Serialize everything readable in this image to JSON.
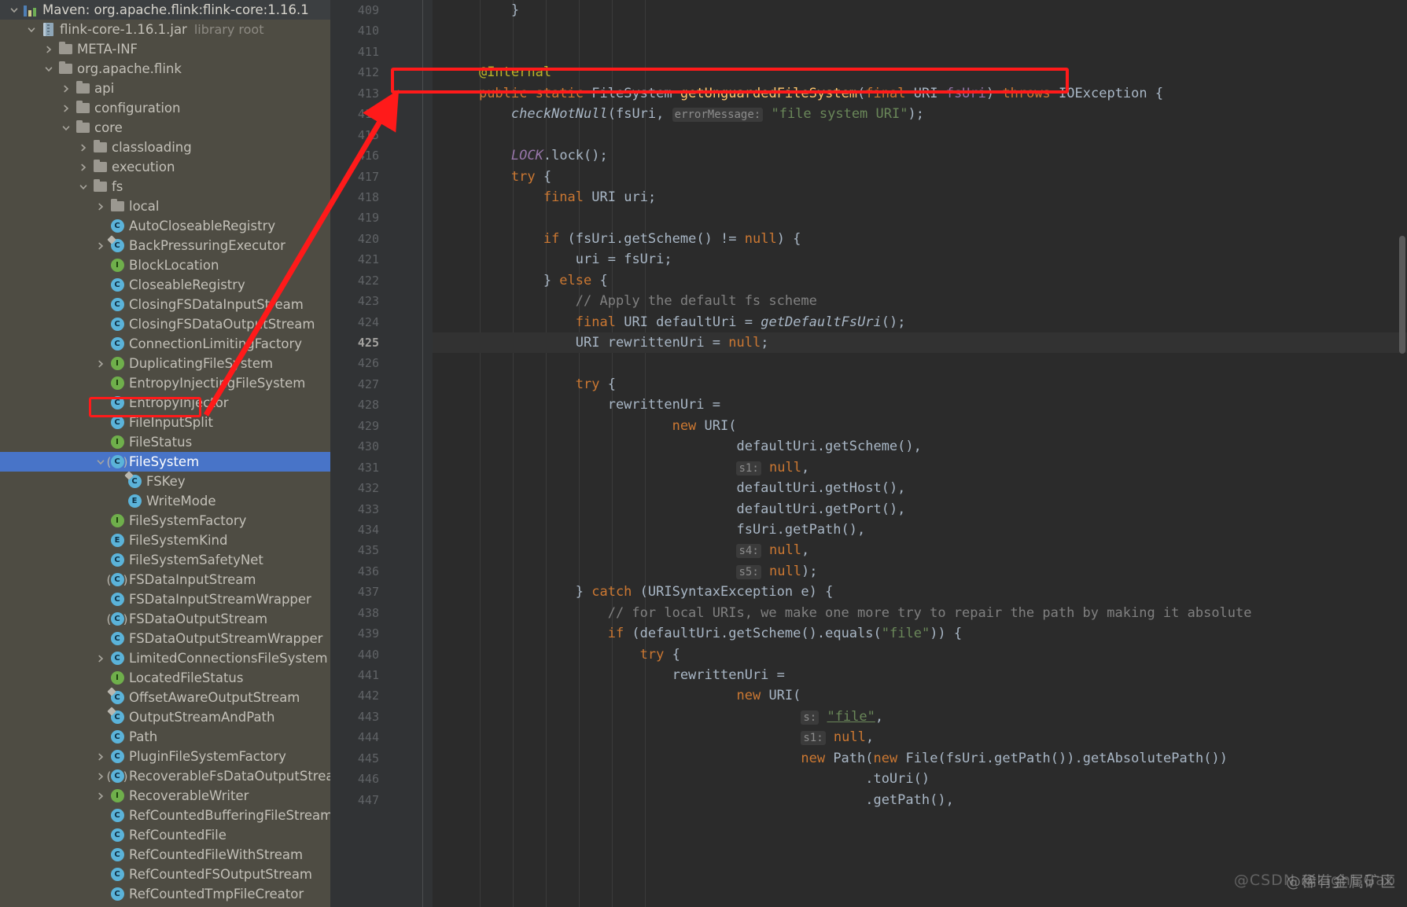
{
  "tree": {
    "panel_name": "project-tool-window",
    "rows": [
      {
        "depth": 0,
        "chev": "down",
        "icon": "maven-icon",
        "label": "Maven: org.apache.flink:flink-core:1.16.1",
        "header": true
      },
      {
        "depth": 1,
        "chev": "down",
        "icon": "jar-icon",
        "label": "flink-core-1.16.1.jar",
        "dim": "library root"
      },
      {
        "depth": 2,
        "chev": "right",
        "icon": "folder-icon",
        "label": "META-INF"
      },
      {
        "depth": 2,
        "chev": "down",
        "icon": "folder-icon",
        "label": "org.apache.flink"
      },
      {
        "depth": 3,
        "chev": "right",
        "icon": "folder-icon",
        "label": "api"
      },
      {
        "depth": 3,
        "chev": "right",
        "icon": "folder-icon",
        "label": "configuration"
      },
      {
        "depth": 3,
        "chev": "down",
        "icon": "folder-icon",
        "label": "core"
      },
      {
        "depth": 4,
        "chev": "right",
        "icon": "folder-icon",
        "label": "classloading"
      },
      {
        "depth": 4,
        "chev": "right",
        "icon": "folder-icon",
        "label": "execution"
      },
      {
        "depth": 4,
        "chev": "down",
        "icon": "folder-icon",
        "label": "fs"
      },
      {
        "depth": 5,
        "chev": "right",
        "icon": "folder-icon",
        "label": "local"
      },
      {
        "depth": 5,
        "chev": "none",
        "icon": "class-icon",
        "label": "AutoCloseableRegistry"
      },
      {
        "depth": 5,
        "chev": "right",
        "icon": "class-final-icon",
        "label": "BackPressuringExecutor"
      },
      {
        "depth": 5,
        "chev": "none",
        "icon": "interface-icon",
        "label": "BlockLocation"
      },
      {
        "depth": 5,
        "chev": "none",
        "icon": "class-icon",
        "label": "CloseableRegistry"
      },
      {
        "depth": 5,
        "chev": "none",
        "icon": "class-icon",
        "label": "ClosingFSDataInputStream"
      },
      {
        "depth": 5,
        "chev": "none",
        "icon": "class-icon",
        "label": "ClosingFSDataOutputStream"
      },
      {
        "depth": 5,
        "chev": "none",
        "icon": "class-icon",
        "label": "ConnectionLimitingFactory"
      },
      {
        "depth": 5,
        "chev": "right",
        "icon": "interface-icon",
        "label": "DuplicatingFileSystem"
      },
      {
        "depth": 5,
        "chev": "none",
        "icon": "interface-icon",
        "label": "EntropyInjectingFileSystem"
      },
      {
        "depth": 5,
        "chev": "none",
        "icon": "class-icon",
        "label": "EntropyInjector"
      },
      {
        "depth": 5,
        "chev": "none",
        "icon": "class-icon",
        "label": "FileInputSplit"
      },
      {
        "depth": 5,
        "chev": "none",
        "icon": "interface-icon",
        "label": "FileStatus"
      },
      {
        "depth": 5,
        "chev": "down",
        "icon": "abstract-class-icon",
        "label": "FileSystem",
        "selected": true
      },
      {
        "depth": 6,
        "chev": "none",
        "icon": "class-final-icon",
        "label": "FSKey"
      },
      {
        "depth": 6,
        "chev": "none",
        "icon": "enum-icon",
        "label": "WriteMode"
      },
      {
        "depth": 5,
        "chev": "none",
        "icon": "interface-icon",
        "label": "FileSystemFactory"
      },
      {
        "depth": 5,
        "chev": "none",
        "icon": "enum-icon",
        "label": "FileSystemKind"
      },
      {
        "depth": 5,
        "chev": "none",
        "icon": "class-icon",
        "label": "FileSystemSafetyNet"
      },
      {
        "depth": 5,
        "chev": "none",
        "icon": "abstract-class-icon",
        "label": "FSDataInputStream"
      },
      {
        "depth": 5,
        "chev": "none",
        "icon": "class-icon",
        "label": "FSDataInputStreamWrapper"
      },
      {
        "depth": 5,
        "chev": "none",
        "icon": "abstract-class-icon",
        "label": "FSDataOutputStream"
      },
      {
        "depth": 5,
        "chev": "none",
        "icon": "class-icon",
        "label": "FSDataOutputStreamWrapper"
      },
      {
        "depth": 5,
        "chev": "right",
        "icon": "class-icon",
        "label": "LimitedConnectionsFileSystem"
      },
      {
        "depth": 5,
        "chev": "none",
        "icon": "interface-icon",
        "label": "LocatedFileStatus"
      },
      {
        "depth": 5,
        "chev": "none",
        "icon": "class-final-icon",
        "label": "OffsetAwareOutputStream"
      },
      {
        "depth": 5,
        "chev": "none",
        "icon": "class-final-icon",
        "label": "OutputStreamAndPath"
      },
      {
        "depth": 5,
        "chev": "none",
        "icon": "class-icon",
        "label": "Path"
      },
      {
        "depth": 5,
        "chev": "right",
        "icon": "class-icon",
        "label": "PluginFileSystemFactory"
      },
      {
        "depth": 5,
        "chev": "right",
        "icon": "abstract-class-icon",
        "label": "RecoverableFsDataOutputStream"
      },
      {
        "depth": 5,
        "chev": "right",
        "icon": "interface-icon",
        "label": "RecoverableWriter"
      },
      {
        "depth": 5,
        "chev": "none",
        "icon": "class-icon",
        "label": "RefCountedBufferingFileStream"
      },
      {
        "depth": 5,
        "chev": "none",
        "icon": "class-icon",
        "label": "RefCountedFile"
      },
      {
        "depth": 5,
        "chev": "none",
        "icon": "class-icon",
        "label": "RefCountedFileWithStream"
      },
      {
        "depth": 5,
        "chev": "none",
        "icon": "class-icon",
        "label": "RefCountedFSOutputStream"
      },
      {
        "depth": 5,
        "chev": "none",
        "icon": "class-icon",
        "label": "RefCountedTmpFileCreator"
      }
    ]
  },
  "editor": {
    "first_line_number": 409,
    "current_line_number": 425,
    "annotation_marker": "@",
    "annotation_marker_line": 413,
    "fold_lines": [
      410,
      413,
      417,
      420,
      422,
      427,
      437,
      439,
      440
    ],
    "lines": [
      {
        "n": 409,
        "html": "        }"
      },
      {
        "n": 410,
        "html": ""
      },
      {
        "n": 411,
        "html": ""
      },
      {
        "n": 412,
        "html": "    <span class=\"an\">@Internal</span>"
      },
      {
        "n": 413,
        "html": "    <span class=\"k\">public static</span> <span class=\"ty\">FileSystem</span> <span class=\"m\">getUnguardedFileSystem</span>(<span class=\"k\">final</span> <span class=\"ty\">URI</span> <span class=\"p\">fsUri</span>) <span class=\"k\">throws</span> <span class=\"ty\">IOException</span> {"
      },
      {
        "n": 414,
        "html": "        <span class=\"mi\">checkNotNull</span>(<span class=\"t\">fsUri</span>, <span class=\"hint\">errorMessage:</span> <span class=\"s\">\"file system URI\"</span>);"
      },
      {
        "n": 415,
        "html": ""
      },
      {
        "n": 416,
        "html": "        <span class=\"f\">LOCK</span>.<span class=\"t\">lock</span>();"
      },
      {
        "n": 417,
        "html": "        <span class=\"k\">try</span> {"
      },
      {
        "n": 418,
        "html": "            <span class=\"k\">final</span> <span class=\"ty\">URI</span> <span class=\"t\">uri</span>;"
      },
      {
        "n": 419,
        "html": ""
      },
      {
        "n": 420,
        "html": "            <span class=\"k\">if</span> (<span class=\"t\">fsUri.getScheme</span>() != <span class=\"k\">null</span>) {"
      },
      {
        "n": 421,
        "html": "                <span class=\"t\">uri</span> = <span class=\"t\">fsUri</span>;"
      },
      {
        "n": 422,
        "html": "            } <span class=\"k\">else</span> {"
      },
      {
        "n": 423,
        "html": "                <span class=\"c\">// Apply the default fs scheme</span>"
      },
      {
        "n": 424,
        "html": "                <span class=\"k\">final</span> <span class=\"ty\">URI</span> <span class=\"t\">defaultUri</span> = <span class=\"mi\">getDefaultFsUri</span>();"
      },
      {
        "n": 425,
        "html": "                <span class=\"ty\">URI</span> <span class=\"t\">rewrittenUri</span> = <span class=\"k\">null</span>;"
      },
      {
        "n": 426,
        "html": ""
      },
      {
        "n": 427,
        "html": "                <span class=\"k\">try</span> {"
      },
      {
        "n": 428,
        "html": "                    <span class=\"t\">rewrittenUri</span> ="
      },
      {
        "n": 429,
        "html": "                            <span class=\"k\">new</span> <span class=\"ty\">URI</span>("
      },
      {
        "n": 430,
        "html": "                                    <span class=\"t\">defaultUri.getScheme</span>(),"
      },
      {
        "n": 431,
        "html": "                                    <span class=\"hint\">s1:</span> <span class=\"k\">null</span>,"
      },
      {
        "n": 432,
        "html": "                                    <span class=\"t\">defaultUri.getHost</span>(),"
      },
      {
        "n": 433,
        "html": "                                    <span class=\"t\">defaultUri.getPort</span>(),"
      },
      {
        "n": 434,
        "html": "                                    <span class=\"t\">fsUri.getPath</span>(),"
      },
      {
        "n": 435,
        "html": "                                    <span class=\"hint\">s4:</span> <span class=\"k\">null</span>,"
      },
      {
        "n": 436,
        "html": "                                    <span class=\"hint\">s5:</span> <span class=\"k\">null</span>);"
      },
      {
        "n": 437,
        "html": "                } <span class=\"k\">catch</span> (<span class=\"ty\">URISyntaxException</span> <span class=\"t\">e</span>) {"
      },
      {
        "n": 438,
        "html": "                    <span class=\"c\">// for local URIs, we make one more try to repair the path by making it absolute</span>"
      },
      {
        "n": 439,
        "html": "                    <span class=\"k\">if</span> (<span class=\"t\">defaultUri.getScheme</span>().<span class=\"t\">equals</span>(<span class=\"s\">\"file\"</span>)) {"
      },
      {
        "n": 440,
        "html": "                        <span class=\"k\">try</span> {"
      },
      {
        "n": 441,
        "html": "                            <span class=\"t\">rewrittenUri</span> ="
      },
      {
        "n": 442,
        "html": "                                    <span class=\"k\">new</span> <span class=\"ty\">URI</span>("
      },
      {
        "n": 443,
        "html": "                                            <span class=\"hint\">s:</span> <span class=\"s ul\">\"file\"</span>,"
      },
      {
        "n": 444,
        "html": "                                            <span class=\"hint\">s1:</span> <span class=\"k\">null</span>,"
      },
      {
        "n": 445,
        "html": "                                            <span class=\"k\">new</span> <span class=\"ty\">Path</span>(<span class=\"k\">new</span> <span class=\"ty\">File</span>(<span class=\"t\">fsUri.getPath</span>()).<span class=\"t\">getAbsolutePath</span>())"
      },
      {
        "n": 446,
        "html": "                                                    .<span class=\"t\">toUri</span>()"
      },
      {
        "n": 447,
        "html": "                                                    .<span class=\"t\">getPath</span>(),"
      }
    ]
  },
  "annotations": {
    "code_highlight_label": "getUnguardedFileSystem-signature-highlight",
    "tree_highlight_label": "FileSystem-tree-highlight",
    "arrow_label": "red-pointer-arrow"
  },
  "watermark": {
    "text_cn": "@稀有金属矿区",
    "text_en": "@CSDN @Light Gab"
  }
}
